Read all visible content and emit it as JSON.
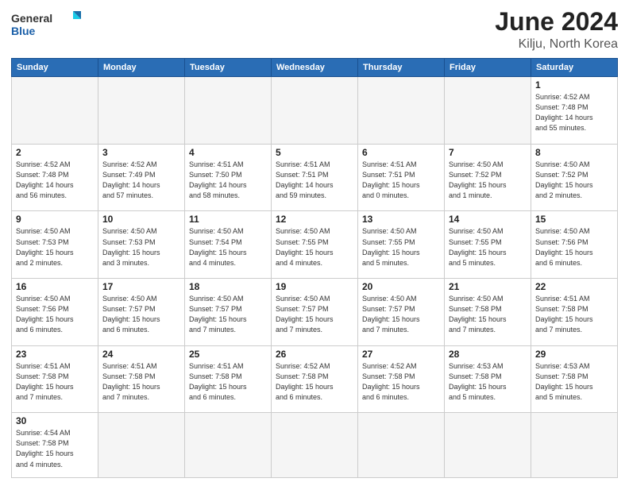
{
  "header": {
    "logo_general": "General",
    "logo_blue": "Blue",
    "title": "June 2024",
    "subtitle": "Kilju, North Korea"
  },
  "weekdays": [
    "Sunday",
    "Monday",
    "Tuesday",
    "Wednesday",
    "Thursday",
    "Friday",
    "Saturday"
  ],
  "days": [
    {
      "num": "",
      "info": ""
    },
    {
      "num": "",
      "info": ""
    },
    {
      "num": "",
      "info": ""
    },
    {
      "num": "",
      "info": ""
    },
    {
      "num": "",
      "info": ""
    },
    {
      "num": "",
      "info": ""
    },
    {
      "num": "1",
      "info": "Sunrise: 4:52 AM\nSunset: 7:48 PM\nDaylight: 14 hours\nand 55 minutes."
    },
    {
      "num": "2",
      "info": "Sunrise: 4:52 AM\nSunset: 7:48 PM\nDaylight: 14 hours\nand 56 minutes."
    },
    {
      "num": "3",
      "info": "Sunrise: 4:52 AM\nSunset: 7:49 PM\nDaylight: 14 hours\nand 57 minutes."
    },
    {
      "num": "4",
      "info": "Sunrise: 4:51 AM\nSunset: 7:50 PM\nDaylight: 14 hours\nand 58 minutes."
    },
    {
      "num": "5",
      "info": "Sunrise: 4:51 AM\nSunset: 7:51 PM\nDaylight: 14 hours\nand 59 minutes."
    },
    {
      "num": "6",
      "info": "Sunrise: 4:51 AM\nSunset: 7:51 PM\nDaylight: 15 hours\nand 0 minutes."
    },
    {
      "num": "7",
      "info": "Sunrise: 4:50 AM\nSunset: 7:52 PM\nDaylight: 15 hours\nand 1 minute."
    },
    {
      "num": "8",
      "info": "Sunrise: 4:50 AM\nSunset: 7:52 PM\nDaylight: 15 hours\nand 2 minutes."
    },
    {
      "num": "9",
      "info": "Sunrise: 4:50 AM\nSunset: 7:53 PM\nDaylight: 15 hours\nand 2 minutes."
    },
    {
      "num": "10",
      "info": "Sunrise: 4:50 AM\nSunset: 7:53 PM\nDaylight: 15 hours\nand 3 minutes."
    },
    {
      "num": "11",
      "info": "Sunrise: 4:50 AM\nSunset: 7:54 PM\nDaylight: 15 hours\nand 4 minutes."
    },
    {
      "num": "12",
      "info": "Sunrise: 4:50 AM\nSunset: 7:55 PM\nDaylight: 15 hours\nand 4 minutes."
    },
    {
      "num": "13",
      "info": "Sunrise: 4:50 AM\nSunset: 7:55 PM\nDaylight: 15 hours\nand 5 minutes."
    },
    {
      "num": "14",
      "info": "Sunrise: 4:50 AM\nSunset: 7:55 PM\nDaylight: 15 hours\nand 5 minutes."
    },
    {
      "num": "15",
      "info": "Sunrise: 4:50 AM\nSunset: 7:56 PM\nDaylight: 15 hours\nand 6 minutes."
    },
    {
      "num": "16",
      "info": "Sunrise: 4:50 AM\nSunset: 7:56 PM\nDaylight: 15 hours\nand 6 minutes."
    },
    {
      "num": "17",
      "info": "Sunrise: 4:50 AM\nSunset: 7:57 PM\nDaylight: 15 hours\nand 6 minutes."
    },
    {
      "num": "18",
      "info": "Sunrise: 4:50 AM\nSunset: 7:57 PM\nDaylight: 15 hours\nand 7 minutes."
    },
    {
      "num": "19",
      "info": "Sunrise: 4:50 AM\nSunset: 7:57 PM\nDaylight: 15 hours\nand 7 minutes."
    },
    {
      "num": "20",
      "info": "Sunrise: 4:50 AM\nSunset: 7:57 PM\nDaylight: 15 hours\nand 7 minutes."
    },
    {
      "num": "21",
      "info": "Sunrise: 4:50 AM\nSunset: 7:58 PM\nDaylight: 15 hours\nand 7 minutes."
    },
    {
      "num": "22",
      "info": "Sunrise: 4:51 AM\nSunset: 7:58 PM\nDaylight: 15 hours\nand 7 minutes."
    },
    {
      "num": "23",
      "info": "Sunrise: 4:51 AM\nSunset: 7:58 PM\nDaylight: 15 hours\nand 7 minutes."
    },
    {
      "num": "24",
      "info": "Sunrise: 4:51 AM\nSunset: 7:58 PM\nDaylight: 15 hours\nand 7 minutes."
    },
    {
      "num": "25",
      "info": "Sunrise: 4:51 AM\nSunset: 7:58 PM\nDaylight: 15 hours\nand 6 minutes."
    },
    {
      "num": "26",
      "info": "Sunrise: 4:52 AM\nSunset: 7:58 PM\nDaylight: 15 hours\nand 6 minutes."
    },
    {
      "num": "27",
      "info": "Sunrise: 4:52 AM\nSunset: 7:58 PM\nDaylight: 15 hours\nand 6 minutes."
    },
    {
      "num": "28",
      "info": "Sunrise: 4:53 AM\nSunset: 7:58 PM\nDaylight: 15 hours\nand 5 minutes."
    },
    {
      "num": "29",
      "info": "Sunrise: 4:53 AM\nSunset: 7:58 PM\nDaylight: 15 hours\nand 5 minutes."
    },
    {
      "num": "30",
      "info": "Sunrise: 4:54 AM\nSunset: 7:58 PM\nDaylight: 15 hours\nand 4 minutes."
    }
  ]
}
